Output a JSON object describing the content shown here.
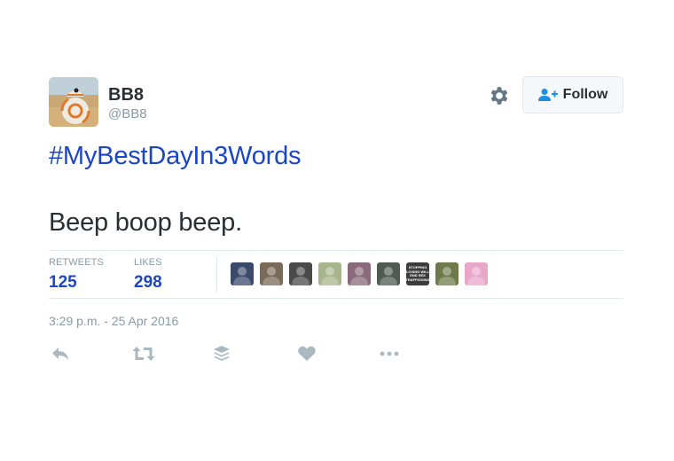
{
  "user": {
    "name": "BB8",
    "handle": "@BB8",
    "avatar_icon": "bb8-droid-avatar"
  },
  "header": {
    "settings_icon": "gear-icon",
    "follow_label": "Follow",
    "follow_icon": "add-user-icon"
  },
  "tweet": {
    "hashtag": "#MyBestDayIn3Words",
    "text": "Beep boop beep."
  },
  "stats": {
    "retweets_label": "RETWEETS",
    "retweets_count": "125",
    "likes_label": "LIKES",
    "likes_count": "298"
  },
  "likers": [
    {
      "icon": "liker-avatar",
      "color": "#3a4a6b"
    },
    {
      "icon": "liker-avatar",
      "color": "#7a6a58"
    },
    {
      "icon": "liker-avatar",
      "color": "#4a4a4a"
    },
    {
      "icon": "liker-avatar",
      "color": "#a8b48c"
    },
    {
      "icon": "liker-avatar",
      "color": "#8a6a7a"
    },
    {
      "icon": "liker-avatar",
      "color": "#4e5a52"
    },
    {
      "icon": "liker-avatar",
      "color": "#3c3c3c",
      "text": [
        "STOPPING",
        "LOVING WILL",
        "END SEX",
        "TRAFFICKING"
      ]
    },
    {
      "icon": "liker-avatar",
      "color": "#6f7a4a"
    },
    {
      "icon": "liker-avatar",
      "color": "#e8a6c8"
    }
  ],
  "timestamp": "3:29 p.m. - 25 Apr 2016",
  "actions": [
    "reply-icon",
    "retweet-icon",
    "buffer-icon",
    "like-heart-icon",
    "more-icon"
  ],
  "colors": {
    "link": "#1b46c6",
    "muted": "#8899a6",
    "text": "#292f33",
    "border": "#e1e8ed"
  }
}
